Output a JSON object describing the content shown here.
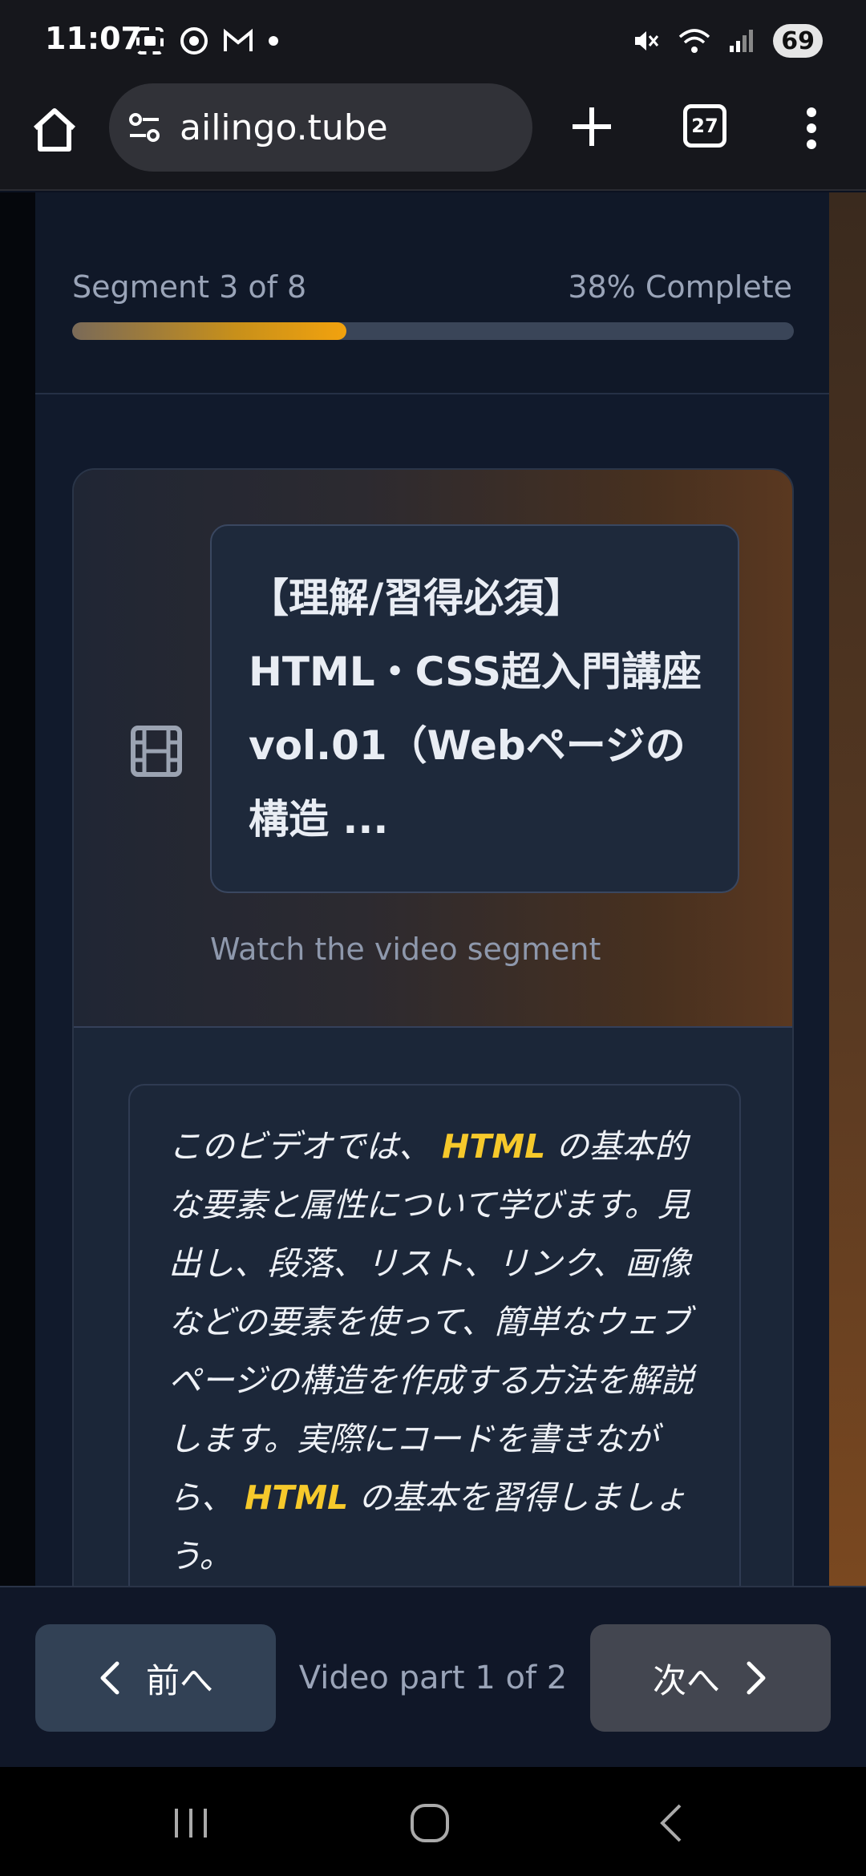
{
  "status_bar": {
    "time": "11:07",
    "battery": "69",
    "left_icons": [
      "screenshot-icon",
      "chrome-icon",
      "gmail-icon",
      "dot-icon"
    ],
    "right_icons": [
      "mute-icon",
      "wifi-icon",
      "signal-icon",
      "battery-icon"
    ]
  },
  "browser": {
    "url": "ailingo.tube",
    "tab_count": "27"
  },
  "progress": {
    "segment_label": "Segment 3 of 8",
    "percent_label": "38% Complete",
    "percent_value": 38
  },
  "video": {
    "title": "【理解/習得必須】HTML・CSS超入門講座vol.01（Webページの構造 ...",
    "watch_label": "Watch the video segment"
  },
  "description": {
    "segments": [
      {
        "text": "このビデオでは、 ",
        "highlight": false
      },
      {
        "text": "HTML",
        "highlight": true
      },
      {
        "text": " の基本的な要素と属性について学びます。見出し、段落、リスト、リンク、画像などの要素を使って、簡単なウェブページの構造を作成する方法を解説します。実際にコードを書きながら、 ",
        "highlight": false
      },
      {
        "text": "HTML",
        "highlight": true
      },
      {
        "text": " の基本を習得しましょう。",
        "highlight": false
      }
    ]
  },
  "nav": {
    "prev_label": "前へ",
    "next_label": "次へ",
    "part_label": "Video part 1 of 2"
  },
  "colors": {
    "accent": "#f2a20e",
    "highlight": "#f6c92b",
    "background": "#111a2c"
  }
}
